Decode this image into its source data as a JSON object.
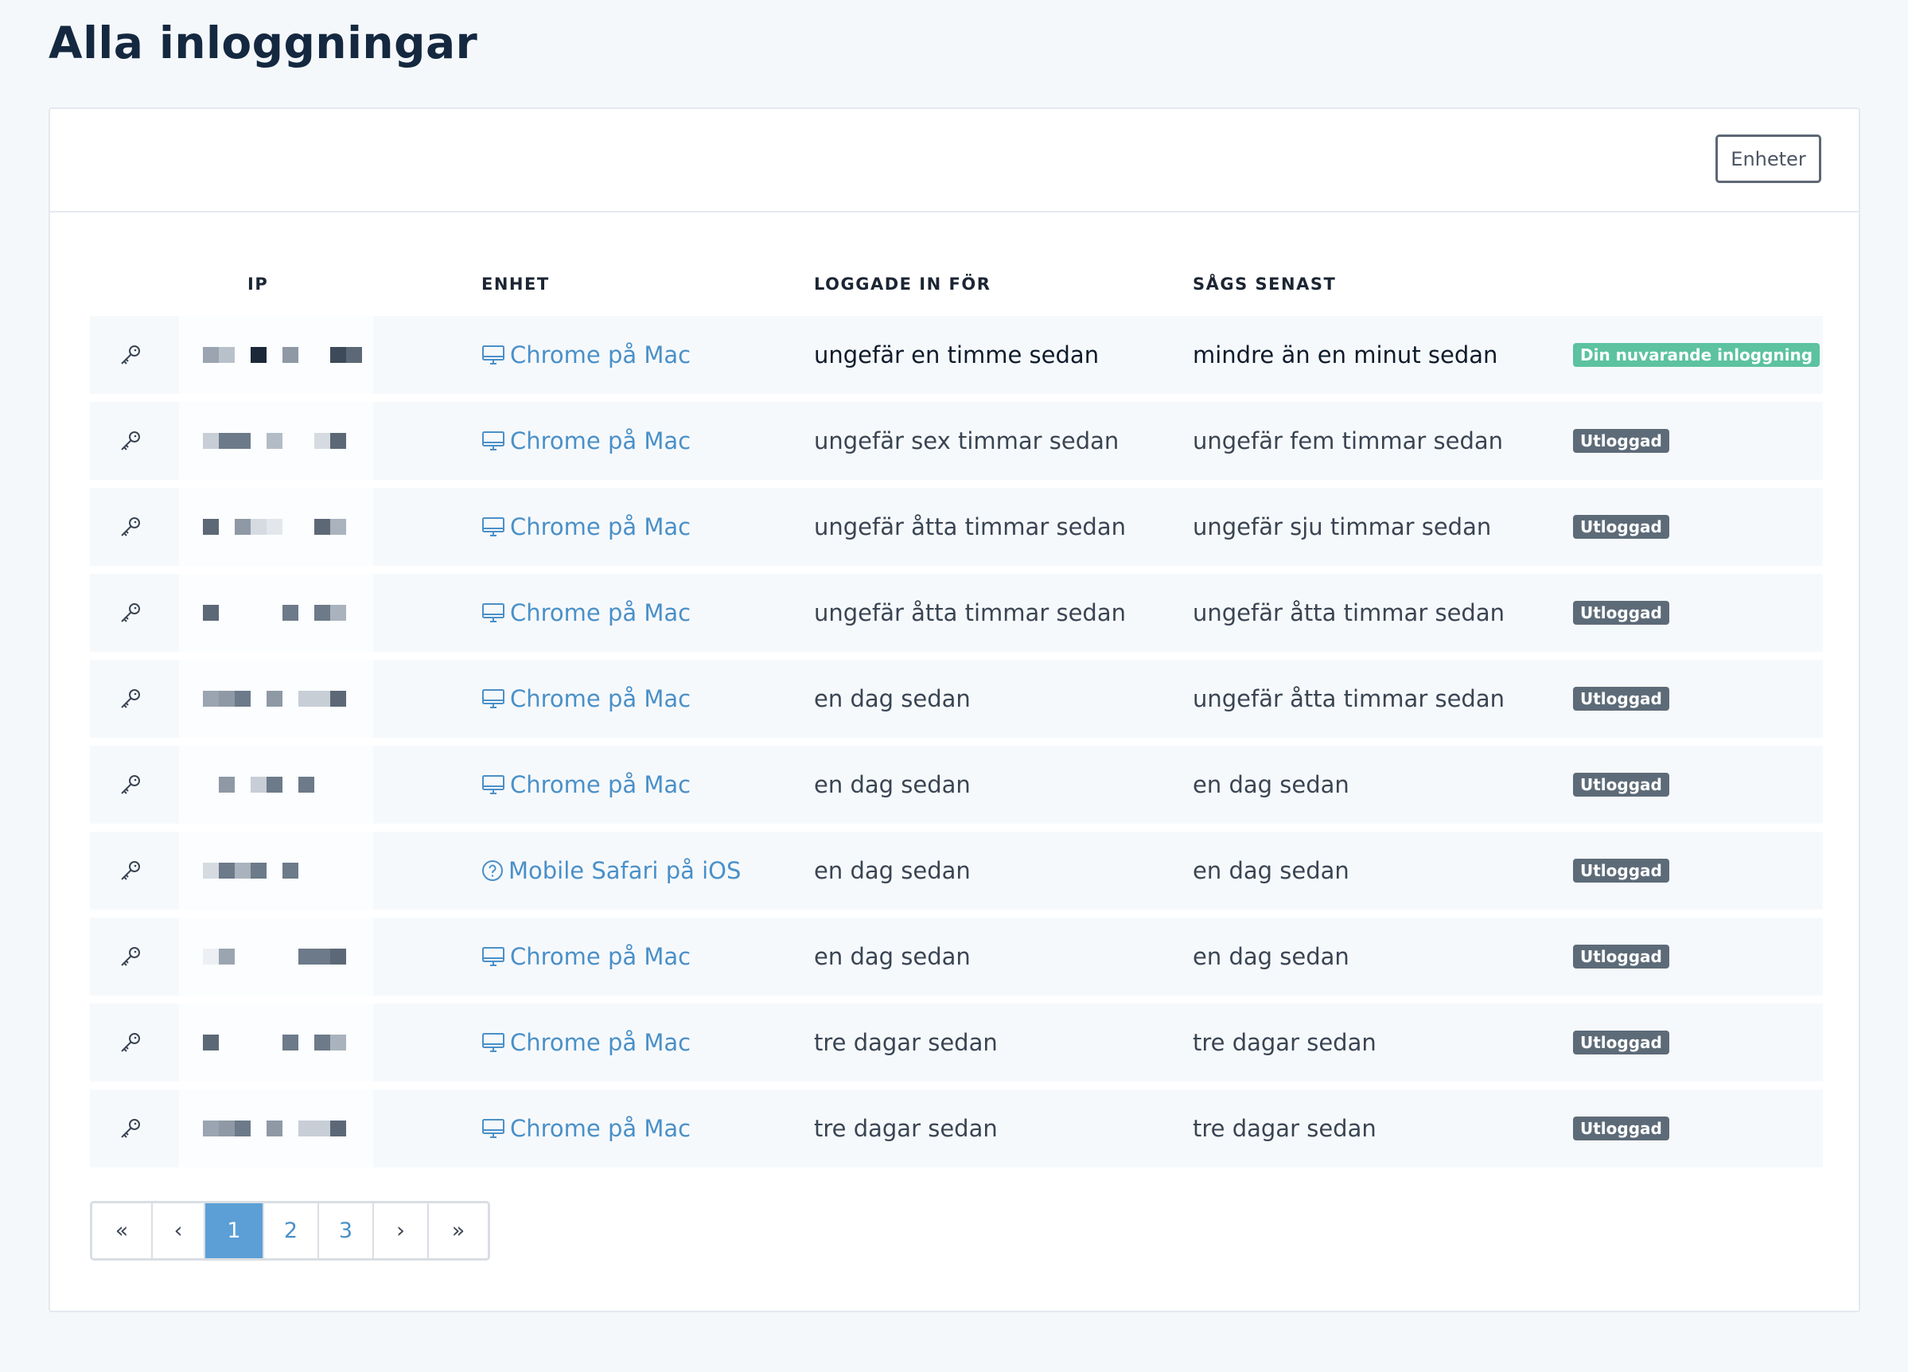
{
  "page": {
    "title": "Alla inloggningar"
  },
  "toolbar": {
    "devices_button": "Enheter"
  },
  "colors": {
    "link": "#4a90c8",
    "current_badge": "#5cc2a0",
    "logged_out_badge": "#5d6b78",
    "active_page": "#5b9fd6"
  },
  "table": {
    "columns": {
      "ip": "IP",
      "device": "ENHET",
      "logged_in": "LOGGADE IN FÖR",
      "last_seen": "SÅGS SENAST"
    },
    "rows": [
      {
        "device": "Chrome på Mac",
        "device_icon": "monitor-icon",
        "logged_in": "ungefär en timme sedan",
        "last_seen": "mindre än en minut sedan",
        "status": "Din nuvarande inloggning",
        "current": true
      },
      {
        "device": "Chrome på Mac",
        "device_icon": "monitor-icon",
        "logged_in": "ungefär sex timmar sedan",
        "last_seen": "ungefär fem timmar sedan",
        "status": "Utloggad",
        "current": false
      },
      {
        "device": "Chrome på Mac",
        "device_icon": "monitor-icon",
        "logged_in": "ungefär åtta timmar sedan",
        "last_seen": "ungefär sju timmar sedan",
        "status": "Utloggad",
        "current": false
      },
      {
        "device": "Chrome på Mac",
        "device_icon": "monitor-icon",
        "logged_in": "ungefär åtta timmar sedan",
        "last_seen": "ungefär åtta timmar sedan",
        "status": "Utloggad",
        "current": false
      },
      {
        "device": "Chrome på Mac",
        "device_icon": "monitor-icon",
        "logged_in": "en dag sedan",
        "last_seen": "ungefär åtta timmar sedan",
        "status": "Utloggad",
        "current": false
      },
      {
        "device": "Chrome på Mac",
        "device_icon": "monitor-icon",
        "logged_in": "en dag sedan",
        "last_seen": "en dag sedan",
        "status": "Utloggad",
        "current": false
      },
      {
        "device": "Mobile Safari på iOS",
        "device_icon": "question-circle-icon",
        "logged_in": "en dag sedan",
        "last_seen": "en dag sedan",
        "status": "Utloggad",
        "current": false
      },
      {
        "device": "Chrome på Mac",
        "device_icon": "monitor-icon",
        "logged_in": "en dag sedan",
        "last_seen": "en dag sedan",
        "status": "Utloggad",
        "current": false
      },
      {
        "device": "Chrome på Mac",
        "device_icon": "monitor-icon",
        "logged_in": "tre dagar sedan",
        "last_seen": "tre dagar sedan",
        "status": "Utloggad",
        "current": false
      },
      {
        "device": "Chrome på Mac",
        "device_icon": "monitor-icon",
        "logged_in": "tre dagar sedan",
        "last_seen": "tre dagar sedan",
        "status": "Utloggad",
        "current": false
      }
    ]
  },
  "pagination": {
    "first": "«",
    "prev": "‹",
    "next": "›",
    "last": "»",
    "pages": [
      "1",
      "2",
      "3"
    ],
    "current": "1"
  }
}
